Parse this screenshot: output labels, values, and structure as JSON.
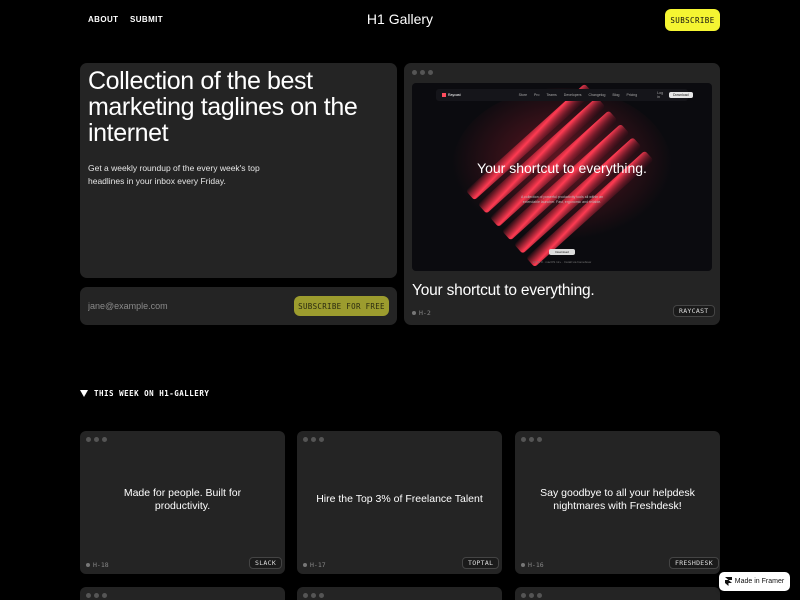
{
  "header": {
    "nav": [
      "ABOUT",
      "SUBMIT"
    ],
    "brand": "H1 Gallery",
    "subscribe_label": "SUBSCRIBE"
  },
  "hero": {
    "title": "Collection of the best marketing taglines on the internet",
    "description": "Get a weekly roundup of the every week's top headlines in your inbox every Friday.",
    "email_placeholder": "jane@example.com",
    "cta_label": "SUBSCRIBE FOR FREE"
  },
  "featured": {
    "title": "Your shortcut to everything.",
    "id": "H-2",
    "tag": "RAYCAST",
    "preview": {
      "logo": "Raycast",
      "links": [
        "Store",
        "Pro",
        "Teams",
        "Developers",
        "Changelog",
        "Blog",
        "Pricing"
      ],
      "login": "Log in",
      "download": "Download",
      "headline": "Your shortcut to everything.",
      "body": "A collection of powerful productivity tools all within an extendable launcher. Fast, ergonomic and reliable.",
      "cta": "Download",
      "footer": "v1.56.0  ·  macOS 12+  ·  Install via homebrew"
    }
  },
  "section": {
    "title": "THIS WEEK ON H1-GALLERY"
  },
  "cards": [
    {
      "text": "Made for people. Built for productivity.",
      "id": "H-18",
      "tag": "SLACK"
    },
    {
      "text": "Hire the Top 3% of Freelance Talent",
      "id": "H-17",
      "tag": "TOPTAL"
    },
    {
      "text": "Say goodbye to all your helpdesk nightmares with Freshdesk!",
      "id": "H-16",
      "tag": "FRESHDESK"
    }
  ],
  "framer_badge": "Made in Framer",
  "colors": {
    "accent_yellow": "#f5f532",
    "muted_yellow": "#9c9c2e",
    "panel": "#242424",
    "background": "#000000",
    "raycast_red": "#ff4d5e"
  }
}
